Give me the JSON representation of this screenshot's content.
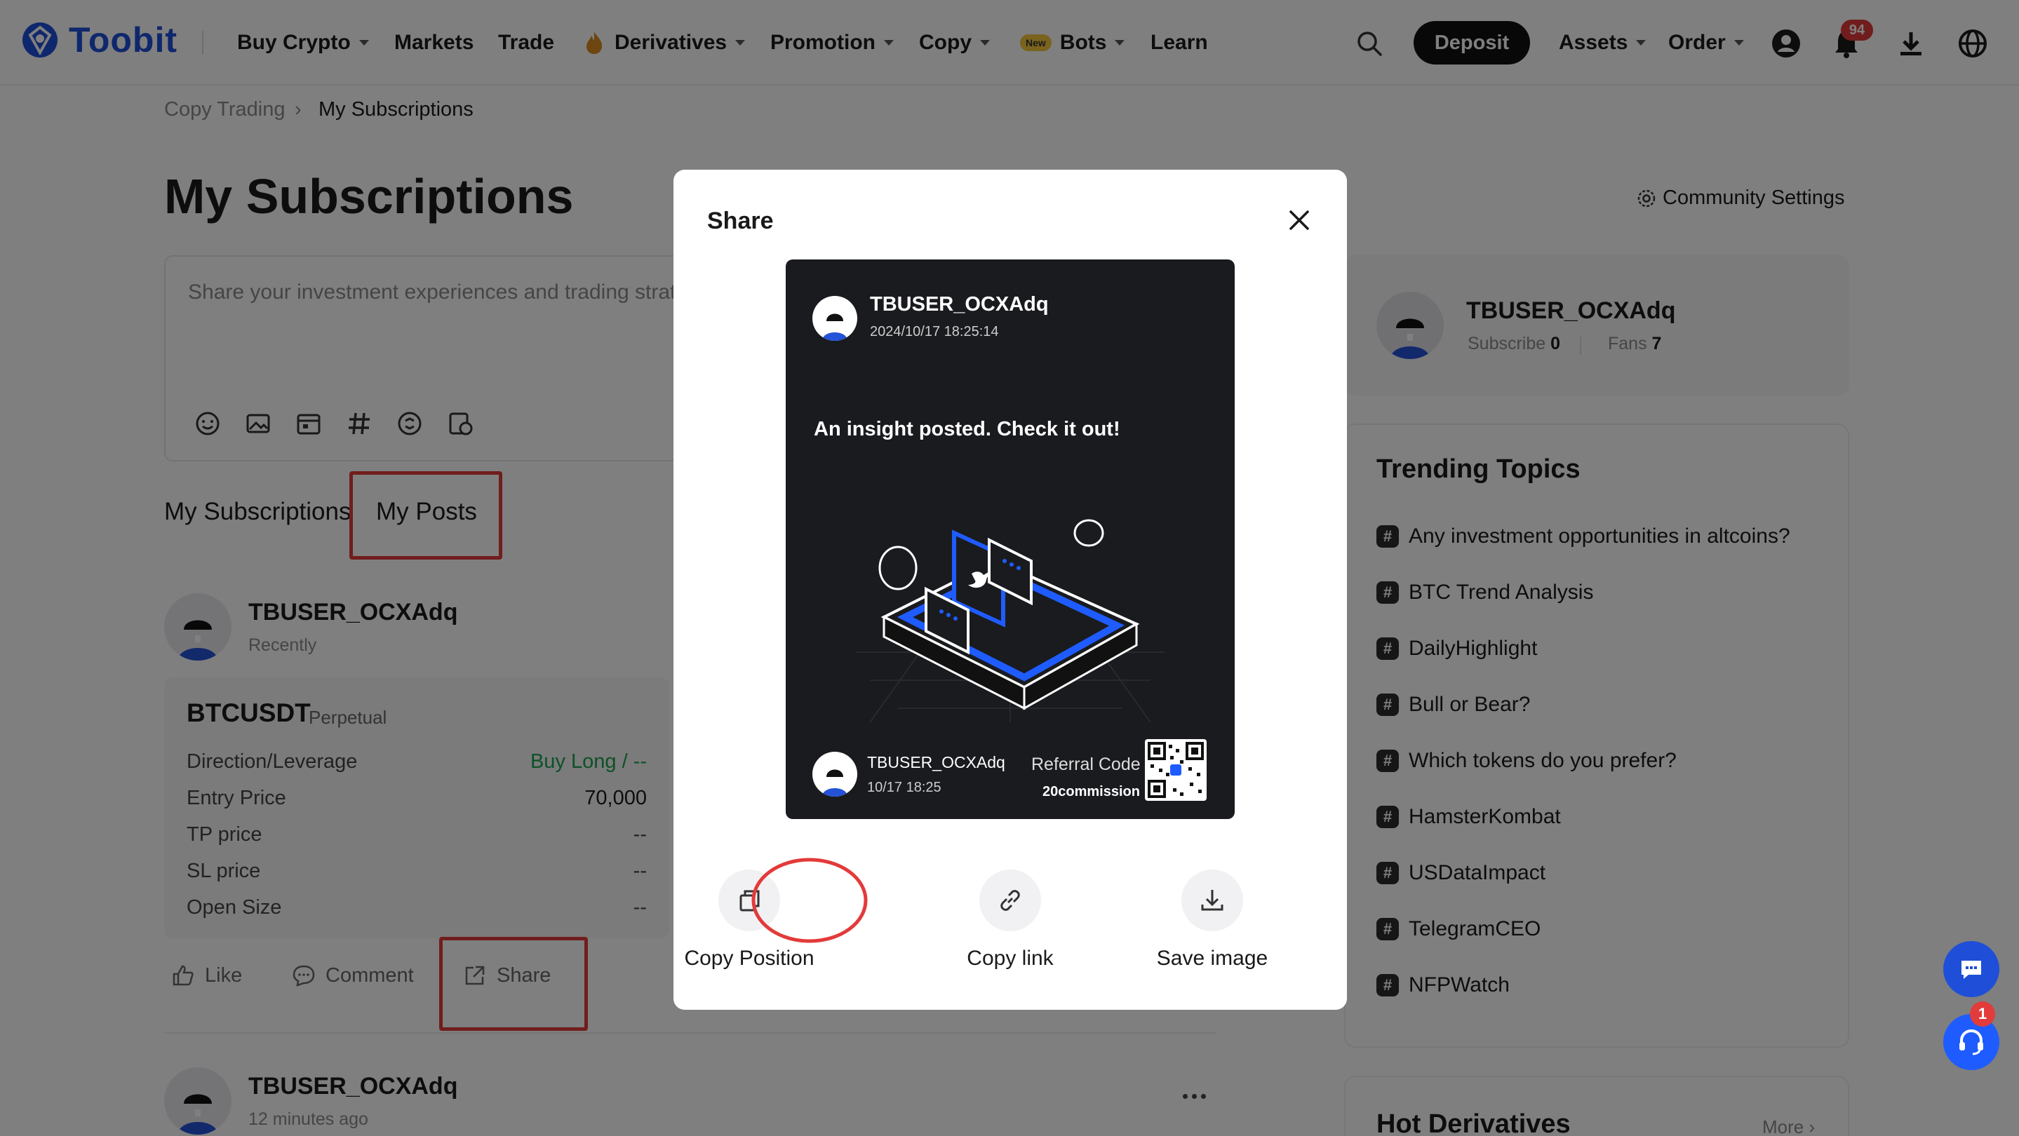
{
  "brand": {
    "name": "Toobit",
    "color": "#1f4fd8"
  },
  "nav": {
    "items": [
      {
        "label": "Buy Crypto",
        "dropdown": true
      },
      {
        "label": "Markets"
      },
      {
        "label": "Trade"
      },
      {
        "label": "Derivatives",
        "dropdown": true,
        "icon": "flame-icon"
      },
      {
        "label": "Promotion",
        "dropdown": true
      },
      {
        "label": "Copy",
        "dropdown": true
      },
      {
        "label": "Bots",
        "dropdown": true,
        "tag": "New"
      },
      {
        "label": "Learn"
      }
    ],
    "deposit": "Deposit",
    "assets": "Assets",
    "order": "Order",
    "notification_count": "94"
  },
  "breadcrumb": {
    "parent": "Copy Trading",
    "current": "My Subscriptions"
  },
  "page_title": "My Subscriptions",
  "community_settings": "Community Settings",
  "composer": {
    "placeholder": "Share your investment experiences and trading strategies"
  },
  "tabs": [
    {
      "label": "My Subscriptions"
    },
    {
      "label": "My Posts",
      "active": true
    }
  ],
  "post1": {
    "user": "TBUSER_OCXAdq",
    "time": "Recently",
    "symbol": "BTCUSDT",
    "type": "Perpetual",
    "rows": [
      {
        "label": "Direction/Leverage",
        "value": "Buy Long / --"
      },
      {
        "label": "Entry Price",
        "value": "70,000"
      },
      {
        "label": "TP price",
        "value": "--"
      },
      {
        "label": "SL price",
        "value": "--"
      },
      {
        "label": "Open Size",
        "value": "--"
      }
    ],
    "actions": {
      "like": "Like",
      "comment": "Comment",
      "share": "Share"
    }
  },
  "post2": {
    "user": "TBUSER_OCXAdq",
    "time": "12 minutes ago"
  },
  "profile": {
    "user": "TBUSER_OCXAdq",
    "subscribe_label": "Subscribe",
    "subscribe_value": "0",
    "fans_label": "Fans",
    "fans_value": "7"
  },
  "trending": {
    "title": "Trending Topics",
    "topics": [
      "Any investment opportunities in altcoins?",
      "BTC Trend Analysis",
      "DailyHighlight",
      "Bull or Bear?",
      "Which tokens do you prefer?",
      "HamsterKombat",
      "USDataImpact",
      "TelegramCEO",
      "NFPWatch"
    ]
  },
  "hot_derivatives": {
    "title": "Hot Derivatives",
    "more": "More"
  },
  "modal": {
    "title": "Share",
    "card": {
      "user": "TBUSER_OCXAdq",
      "datetime": "2024/10/17 18:25:14",
      "message": "An insight posted. Check it out!",
      "footer_user": "TBUSER_OCXAdq",
      "footer_time": "10/17 18:25",
      "referral_label": "Referral Code",
      "referral_value": "20commission"
    },
    "buttons": {
      "copy_position": "Copy Position",
      "copy_link": "Copy link",
      "save_image": "Save image"
    }
  },
  "support_badge": "1",
  "colors": {
    "buy_long": "#1aa34a",
    "highlight": "#e33a3a",
    "accent_blue": "#1f5cff"
  }
}
